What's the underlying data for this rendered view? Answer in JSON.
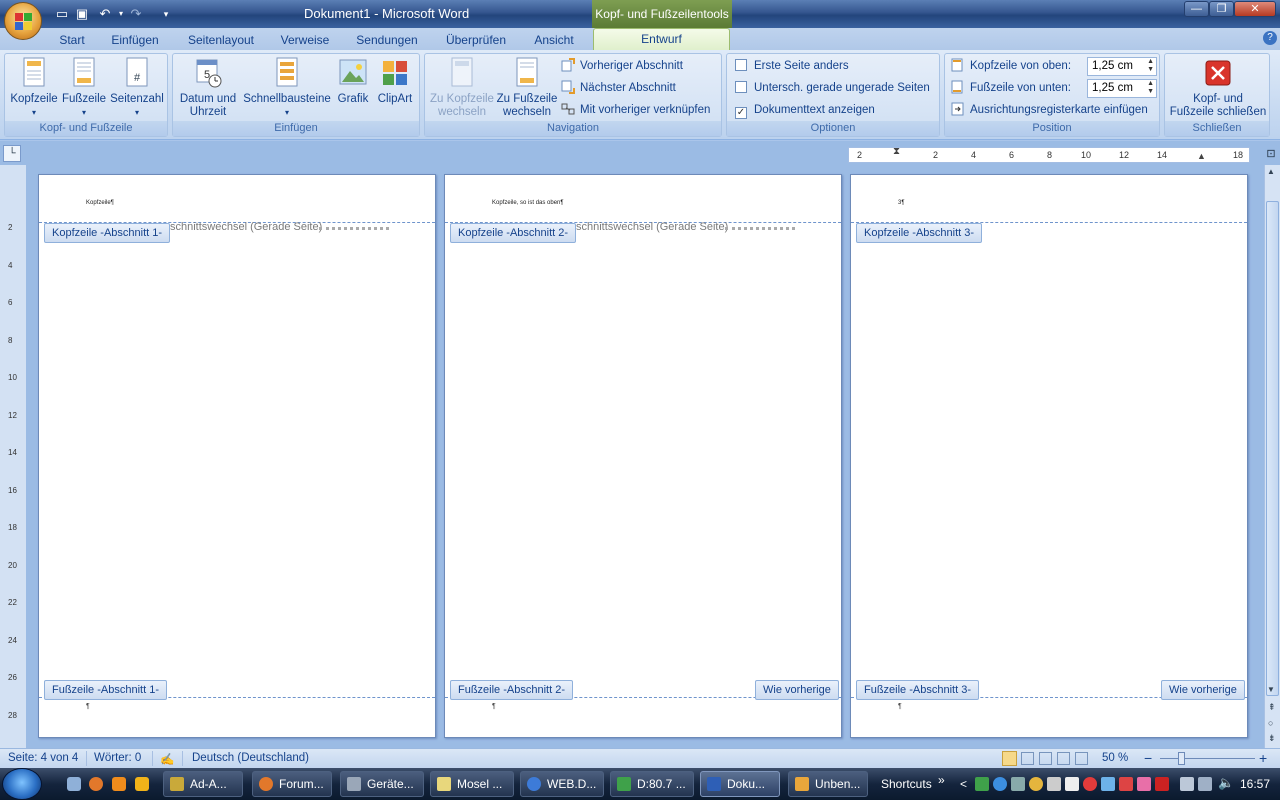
{
  "window": {
    "title": "Dokument1 - Microsoft Word",
    "context_tab_title": "Kopf- und Fußzeilentools"
  },
  "tabs": [
    "Start",
    "Einfügen",
    "Seitenlayout",
    "Verweise",
    "Sendungen",
    "Überprüfen",
    "Ansicht",
    "Entwurf"
  ],
  "active_tab": "Entwurf",
  "ribbon": {
    "groups": {
      "kopf_fuss": {
        "label": "Kopf- und Fußzeile",
        "kopfzeile": "Kopfzeile",
        "fusszeile": "Fußzeile",
        "seitenzahl": "Seitenzahl"
      },
      "einfuegen": {
        "label": "Einfügen",
        "datum_line1": "Datum und",
        "datum_line2": "Uhrzeit",
        "schnellbausteine": "Schnellbausteine",
        "grafik": "Grafik",
        "clipart": "ClipArt"
      },
      "navigation": {
        "label": "Navigation",
        "zu_kopf_line1": "Zu Kopfzeile",
        "zu_kopf_line2": "wechseln",
        "zu_fuss_line1": "Zu Fußzeile",
        "zu_fuss_line2": "wechseln",
        "vorheriger": "Vorheriger Abschnitt",
        "naechster": "Nächster Abschnitt",
        "verknuepfen": "Mit vorheriger verknüpfen"
      },
      "optionen": {
        "label": "Optionen",
        "erste_seite": "Erste Seite anders",
        "erste_seite_checked": false,
        "gerade_ungerade": "Untersch. gerade  ungerade Seiten",
        "gerade_ungerade_checked": false,
        "dokumenttext": "Dokumenttext anzeigen",
        "dokumenttext_checked": true,
        "check_mark": "✓"
      },
      "position": {
        "label": "Position",
        "kopf_von_oben": "Kopfzeile von oben:",
        "kopf_value": "1,25 cm",
        "fuss_von_unten": "Fußzeile von unten:",
        "fuss_value": "1,25 cm",
        "ausrichtung": "Ausrichtungsregisterkarte einfügen"
      },
      "schliessen": {
        "label": "Schließen",
        "btn_line1": "Kopf- und",
        "btn_line2": "Fußzeile schließen"
      }
    }
  },
  "ruler": {
    "horizontal_marks": [
      "2",
      "2",
      "4",
      "6",
      "8",
      "10",
      "12",
      "14",
      "18"
    ],
    "vertical_marks": [
      "2",
      "4",
      "6",
      "8",
      "10",
      "12",
      "14",
      "16",
      "18",
      "20",
      "22",
      "24",
      "26",
      "28"
    ]
  },
  "pages": [
    {
      "header_text": "Kopfzeile¶",
      "header_tag": "Kopfzeile -Abschnitt 1-",
      "break_text": "schnittswechsel (Gerade Seite)",
      "footer_tag": "Fußzeile -Abschnitt 1-",
      "footer_link": "",
      "footer_mark": "¶"
    },
    {
      "header_text": "Kopfzeile, so ist das oben¶",
      "header_tag": "Kopfzeile -Abschnitt 2-",
      "break_text": "schnittswechsel (Gerade Seite)",
      "footer_tag": "Fußzeile -Abschnitt 2-",
      "footer_link": "Wie vorherige",
      "footer_mark": "¶"
    },
    {
      "header_text": "3¶",
      "header_tag": "Kopfzeile -Abschnitt 3-",
      "break_text": "",
      "footer_tag": "Fußzeile -Abschnitt 3-",
      "footer_link": "Wie vorherige",
      "footer_mark": "¶"
    }
  ],
  "statusbar": {
    "page": "Seite: 4 von 4",
    "words": "Wörter: 0",
    "language": "Deutsch (Deutschland)",
    "zoom": "50 %",
    "zoom_minus": "−",
    "zoom_plus": "+"
  },
  "taskbar": {
    "buttons": [
      "Ad-A...",
      "Forum...",
      "Geräte...",
      "Mosel ...",
      "WEB.D...",
      "D:80.7 ...",
      "Doku...",
      "Unben..."
    ],
    "active_index": 6,
    "shortcuts": "Shortcuts",
    "shortcuts_chevron": "»",
    "tray_chevron": "<",
    "clock": "16:57"
  },
  "colors": {
    "accent": "#15428b",
    "context_tab": "#6a8b40",
    "close_red": "#d9342b"
  }
}
